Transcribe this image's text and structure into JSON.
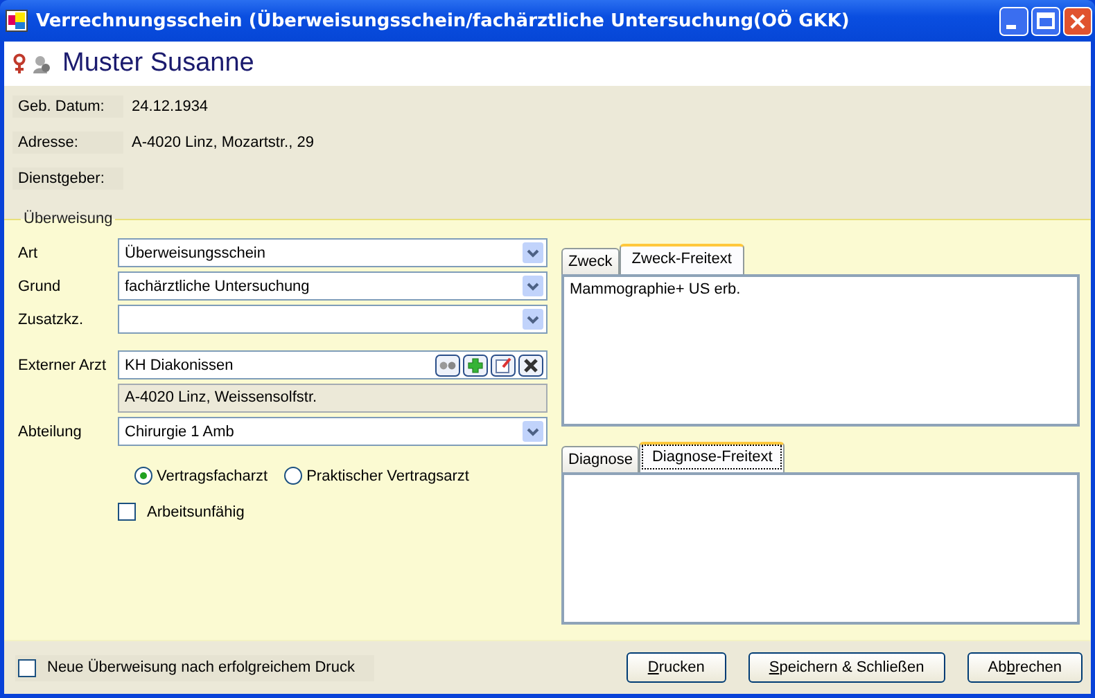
{
  "window": {
    "title": "Verrechnungsschein (Überweisungsschein/fachärztliche Untersuchung(OÖ GKK)"
  },
  "patient": {
    "name": "Muster Susanne"
  },
  "info": [
    {
      "label": "Geb. Datum:",
      "value": "24.12.1934"
    },
    {
      "label": "Adresse:",
      "value": "A-4020 Linz, Mozartstr., 29"
    },
    {
      "label": "Dienstgeber:"
    }
  ],
  "referral": {
    "title": "Überweisung",
    "fields": [
      {
        "kind": "combo",
        "label": "Art",
        "value": "Überweisungsschein"
      },
      {
        "kind": "combo",
        "label": "Grund",
        "value": "fachärztliche Untersuchung"
      },
      {
        "kind": "combo",
        "label": "Zusatzkz."
      },
      {
        "kind": "lookup",
        "label": "Externer Arzt",
        "value": "KH Diakonissen",
        "address": "A-4020 Linz, Weissensolfstr."
      },
      {
        "kind": "combo",
        "label": "Abteilung",
        "value": "Chirurgie 1 Amb"
      },
      {
        "kind": "radio",
        "options": [
          {
            "label": "Vertragsfacharzt",
            "selected": true
          },
          {
            "label": "Praktischer Vertragsarzt",
            "selected": false
          }
        ]
      },
      {
        "kind": "checkbox",
        "label": "Arbeitsunfähig",
        "checked": false
      }
    ],
    "panels": [
      {
        "tabs": [
          {
            "label": "Zweck",
            "selected": false
          },
          {
            "label": "Zweck-Freitext",
            "selected": true
          }
        ],
        "text": "Mammographie+ US erb."
      },
      {
        "tabs": [
          {
            "label": "Diagnose",
            "selected": false
          },
          {
            "label": "Diagnose-Freitext",
            "selected": true
          }
        ]
      }
    ]
  },
  "footer": {
    "checkbox": {
      "label": "Neue Überweisung nach erfolgreichem Druck",
      "checked": false
    },
    "buttons": [
      {
        "segments": [
          {
            "text": "D",
            "underlined": true
          },
          {
            "text": "rucken",
            "underlined": false
          }
        ]
      },
      {
        "segments": [
          {
            "text": "S",
            "underlined": true
          },
          {
            "text": "peichern & Schließen",
            "underlined": false
          }
        ]
      },
      {
        "segments": [
          {
            "text": "Ab",
            "underlined": false
          },
          {
            "text": "b",
            "underlined": true
          },
          {
            "text": "rechen",
            "underlined": false
          }
        ]
      }
    ]
  }
}
